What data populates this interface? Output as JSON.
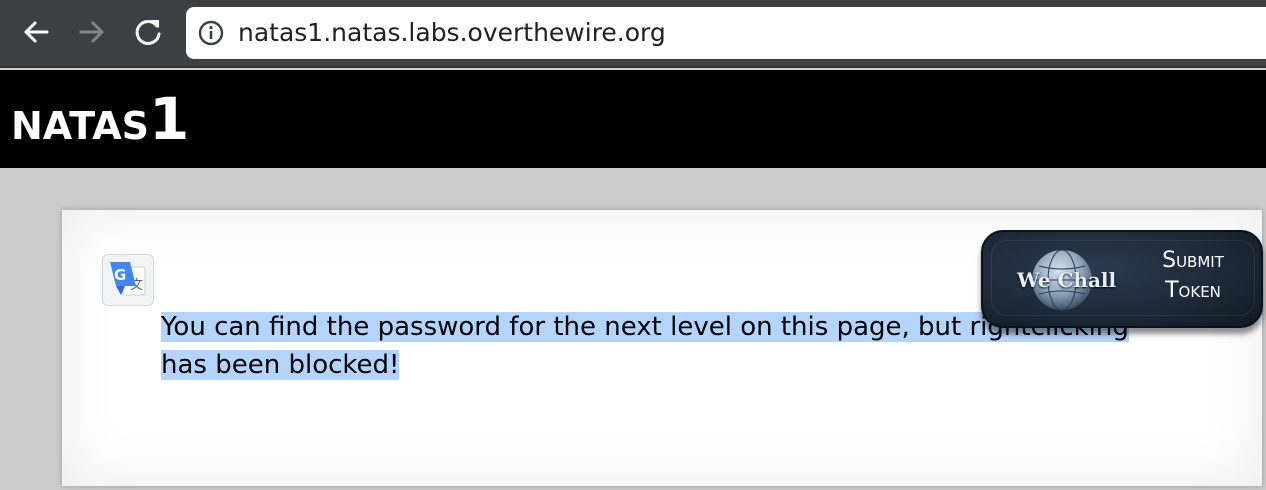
{
  "browser": {
    "url": "natas1.natas.labs.overthewire.org",
    "icons": {
      "back": "back-arrow-icon",
      "forward": "forward-arrow-icon",
      "reload": "reload-icon",
      "info": "info-icon"
    }
  },
  "header": {
    "title_prefix": "NATAS",
    "title_number": "1"
  },
  "content": {
    "message": "You can find the password for the next level on this page, but rightclicking has been blocked!",
    "message_line1": "You can find the password for the next level on this page, but ",
    "message_hidden_part": "rightclicking",
    "message_line2": "has been blocked!",
    "translate_icon": "google-translate-icon"
  },
  "wechall": {
    "logo_text": "We Chall",
    "submit_label": "Submit",
    "token_label": "Token"
  },
  "colors": {
    "browser_bar": "#3c4043",
    "header_bg": "#000000",
    "page_bg": "#cccccc",
    "selection": "#b3d4fc",
    "wechall_bg": "#1b2836"
  }
}
